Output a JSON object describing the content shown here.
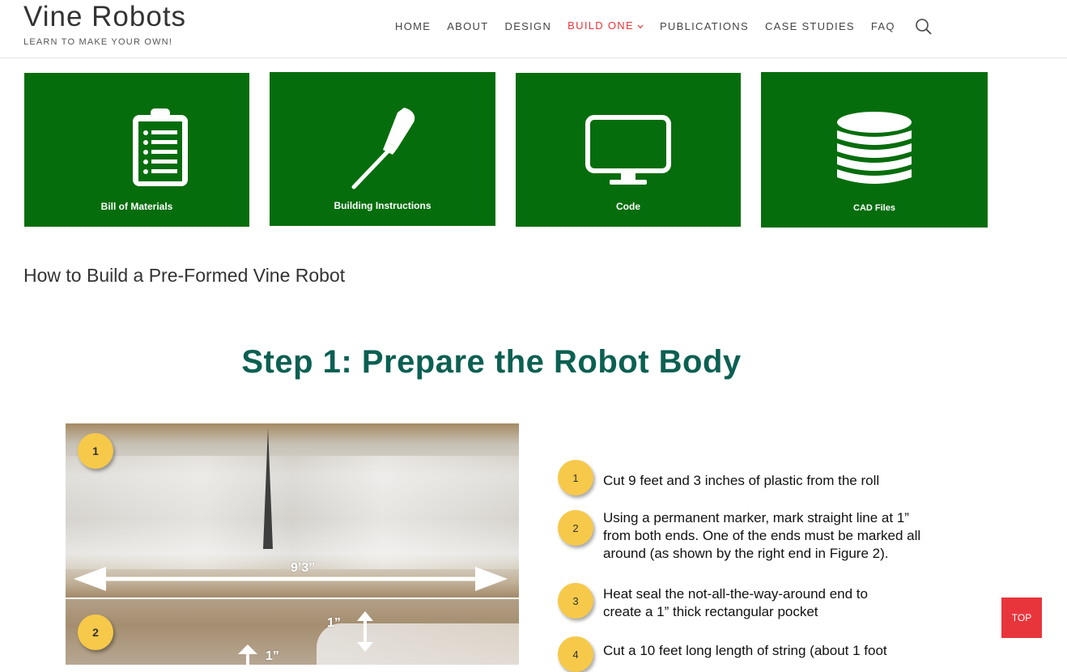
{
  "site": {
    "title": "Vine Robots",
    "tagline": "LEARN TO MAKE YOUR OWN!"
  },
  "nav": {
    "items": [
      "HOME",
      "ABOUT",
      "DESIGN",
      "BUILD ONE",
      "PUBLICATIONS",
      "CASE STUDIES",
      "FAQ"
    ],
    "active": "BUILD ONE",
    "active_color": "#e8353b"
  },
  "tiles": [
    {
      "label": "Bill of Materials",
      "icon": "clipboard-list-icon"
    },
    {
      "label": "Building Instructions",
      "icon": "screwdriver-icon"
    },
    {
      "label": "Code",
      "icon": "monitor-icon"
    },
    {
      "label": "CAD Files",
      "icon": "database-icon"
    }
  ],
  "tile_color": "#066d0c",
  "page_title": "How to Build a Pre-Formed Vine Robot",
  "step_title": "Step 1: Prepare the Robot Body",
  "step_title_color": "#0b6052",
  "photo": {
    "badges": [
      "1",
      "2"
    ],
    "length_label": "9’3”",
    "inch_label_a": "1”",
    "inch_label_b": "1”"
  },
  "steps": [
    {
      "number": "1",
      "text": "Cut 9 feet and 3 inches of plastic from the roll"
    },
    {
      "number": "2",
      "text": "Using a permanent marker, mark straight line at 1” from both ends.  One of the ends must be marked all around (as shown by the right end in Figure 2)."
    },
    {
      "number": "3",
      "text": "Heat seal the not-all-the-way-around end to create a 1” thick rectangular pocket"
    },
    {
      "number": "4",
      "text": "Cut a 10 feet long  length of string (about 1 foot"
    }
  ],
  "top_button": "TOP"
}
